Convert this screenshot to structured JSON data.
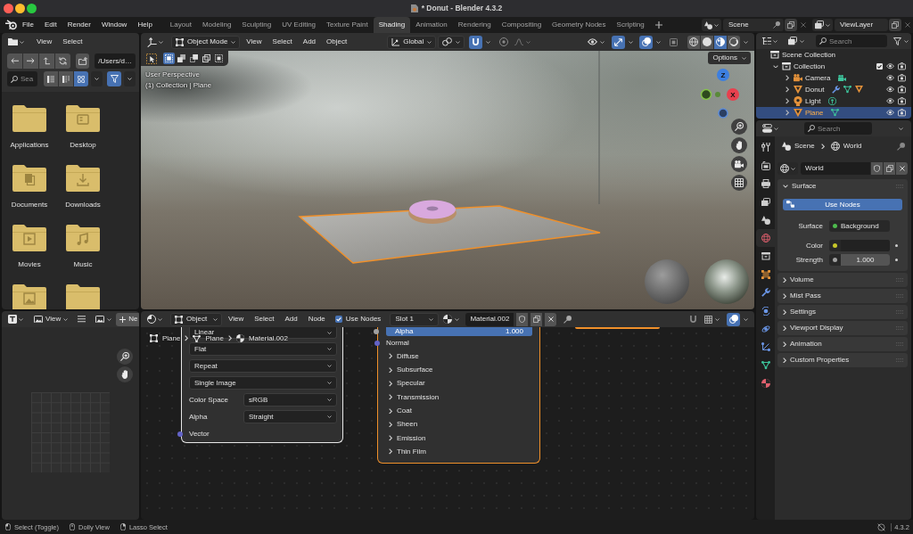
{
  "window": {
    "title": "* Donut - Blender 4.3.2"
  },
  "menu": [
    "File",
    "Edit",
    "Render",
    "Window",
    "Help"
  ],
  "workspaces": [
    {
      "label": "Layout",
      "selected": false
    },
    {
      "label": "Modeling",
      "selected": false
    },
    {
      "label": "Sculpting",
      "selected": false
    },
    {
      "label": "UV Editing",
      "selected": false
    },
    {
      "label": "Texture Paint",
      "selected": false
    },
    {
      "label": "Shading",
      "selected": true
    },
    {
      "label": "Animation",
      "selected": false
    },
    {
      "label": "Rendering",
      "selected": false
    },
    {
      "label": "Compositing",
      "selected": false
    },
    {
      "label": "Geometry Nodes",
      "selected": false
    },
    {
      "label": "Scripting",
      "selected": false
    }
  ],
  "scene": "Scene",
  "view_layer": "ViewLayer",
  "file_browser": {
    "menus": [
      "View",
      "Select"
    ],
    "path": "/Users/d…",
    "search": {
      "placeholder": "Sea"
    },
    "display_modes": [
      {
        "kind": "vertical",
        "selected": false
      },
      {
        "kind": "horizontal",
        "selected": false
      },
      {
        "kind": "thumbnails",
        "selected": true
      }
    ],
    "filter": {
      "on": true
    },
    "folders": [
      {
        "name": "Applications",
        "kind": "plain"
      },
      {
        "name": "Desktop",
        "kind": "desktop"
      },
      {
        "name": "Documents",
        "kind": "documents"
      },
      {
        "name": "Downloads",
        "kind": "downloads"
      },
      {
        "name": "Movies",
        "kind": "movies"
      },
      {
        "name": "Music",
        "kind": "music"
      },
      {
        "kind": "pictures"
      },
      {
        "kind": "plain"
      }
    ]
  },
  "image_editor": {
    "mode": "View",
    "new_label": "Ne"
  },
  "viewport": {
    "mode": "Object Mode",
    "menus": [
      "View",
      "Select",
      "Add",
      "Object"
    ],
    "orientation": "Global",
    "snapping": {
      "on": true
    },
    "proportional_editing": {
      "on": false
    },
    "gizmos": {
      "on": true
    },
    "overlays": {
      "on": true
    },
    "xray": {
      "on": false
    },
    "shading_modes": [
      {
        "kind": "wireframe",
        "selected": false
      },
      {
        "kind": "solid",
        "selected": false
      },
      {
        "kind": "material",
        "selected": true
      },
      {
        "kind": "rendered",
        "selected": false
      }
    ],
    "select_modes": [
      {
        "kind": "set",
        "selected": true
      },
      {
        "kind": "extend",
        "selected": false
      },
      {
        "kind": "subtract",
        "selected": false
      },
      {
        "kind": "difference",
        "selected": false
      },
      {
        "kind": "intersect",
        "selected": false
      }
    ],
    "info": [
      "User Perspective",
      "(1) Collection | Plane"
    ],
    "options": "Options",
    "gizmo_axes": [
      {
        "label": "Z",
        "color": "#3d7fe0"
      },
      {
        "label": "X",
        "color": "#e8404e"
      }
    ]
  },
  "shader_editor": {
    "object_type": "Object",
    "menus": [
      "View",
      "Select",
      "Add",
      "Node"
    ],
    "use_nodes": {
      "label": "Use Nodes",
      "checked": true
    },
    "slot": "Slot 1",
    "material": "Material.002",
    "snapping": {
      "on": false
    },
    "overlays": {
      "on": true
    },
    "breadcrumb": [
      "Plane",
      "Plane",
      "Material.002"
    ],
    "image_node": {
      "active": true,
      "selected": true,
      "rows": [
        {
          "kind": "dropdown",
          "value": "Linear"
        },
        {
          "kind": "dropdown",
          "value": "Flat"
        },
        {
          "kind": "dropdown",
          "value": "Repeat"
        },
        {
          "kind": "dropdown",
          "value": "Single Image"
        },
        {
          "kind": "property",
          "label": "Color Space",
          "value": "sRGB"
        },
        {
          "kind": "property",
          "label": "Alpha",
          "value": "Straight"
        },
        {
          "kind": "input",
          "label": "Vector",
          "color": "#6363c7"
        }
      ]
    },
    "bsdf_node": {
      "active": false,
      "selected": true,
      "alpha": {
        "label": "Alpha",
        "value": "1.000",
        "level": 1,
        "color": "#a1a1a1"
      },
      "inputs": [
        {
          "label": "Normal",
          "color": "#6363c7"
        }
      ],
      "panels": [
        {
          "label": "Diffuse",
          "expanded": false
        },
        {
          "label": "Subsurface",
          "expanded": false
        },
        {
          "label": "Specular",
          "expanded": false
        },
        {
          "label": "Transmission",
          "expanded": false
        },
        {
          "label": "Coat",
          "expanded": false
        },
        {
          "label": "Sheen",
          "expanded": false
        },
        {
          "label": "Emission",
          "expanded": false
        },
        {
          "label": "Thin Film",
          "expanded": false
        }
      ]
    }
  },
  "outliner": {
    "search": {
      "placeholder": "Search"
    },
    "tree": [
      {
        "name": "Scene Collection",
        "kind": "scene",
        "selected": false,
        "children": [
          {
            "name": "Collection",
            "kind": "collection",
            "selected": false,
            "expanded": true,
            "checked": true,
            "visible": true,
            "children": [
              {
                "name": "Camera",
                "kind": "camera",
                "selected": false,
                "expanded": false,
                "visible": true,
                "badges": [
                  {
                    "kind": "camera-data"
                  }
                ]
              },
              {
                "name": "Donut",
                "kind": "mesh",
                "selected": false,
                "expanded": false,
                "visible": true,
                "badges": [
                  {
                    "kind": "modifier"
                  },
                  {
                    "kind": "mesh-data"
                  },
                  {
                    "kind": "mesh-object"
                  }
                ]
              },
              {
                "name": "Light",
                "kind": "light",
                "selected": false,
                "expanded": false,
                "visible": true,
                "badges": [
                  {
                    "kind": "light-data"
                  }
                ]
              },
              {
                "name": "Plane",
                "kind": "mesh",
                "selected": true,
                "expanded": false,
                "visible": true,
                "badges": [
                  {
                    "kind": "mesh-data"
                  }
                ]
              }
            ]
          }
        ]
      }
    ]
  },
  "properties": {
    "search": {
      "placeholder": "Search"
    },
    "tabs": [
      {
        "kind": "tool",
        "selected": false
      },
      {
        "kind": "render",
        "selected": false
      },
      {
        "kind": "output",
        "selected": false
      },
      {
        "kind": "view-layer",
        "selected": false
      },
      {
        "kind": "scene",
        "selected": false
      },
      {
        "kind": "world",
        "selected": true
      },
      {
        "kind": "collection",
        "selected": false
      },
      {
        "kind": "object",
        "selected": false
      },
      {
        "kind": "modifiers",
        "selected": false
      },
      {
        "kind": "particles",
        "selected": false
      },
      {
        "kind": "physics",
        "selected": false
      },
      {
        "kind": "constraints",
        "selected": false
      },
      {
        "kind": "data",
        "selected": false
      },
      {
        "kind": "material",
        "selected": false
      }
    ],
    "breadcrumb": [
      "Scene",
      "World"
    ],
    "world": "World",
    "panels": [
      {
        "title": "Surface",
        "expanded": true,
        "button": "Use Nodes",
        "rows": [
          {
            "kind": "link",
            "label": "Surface",
            "value": "Background",
            "color": "#4dbb4d"
          },
          {
            "kind": "color",
            "label": "Color",
            "color": "#c7c729"
          },
          {
            "kind": "number",
            "label": "Strength",
            "value": "1.000",
            "color": "#a1a1a1"
          }
        ]
      },
      {
        "title": "Volume",
        "expanded": false
      },
      {
        "title": "Mist Pass",
        "expanded": false
      },
      {
        "title": "Settings",
        "expanded": false
      },
      {
        "title": "Viewport Display",
        "expanded": false
      },
      {
        "title": "Animation",
        "expanded": false
      },
      {
        "title": "Custom Properties",
        "expanded": false
      }
    ]
  },
  "status_bar": {
    "hints": [
      {
        "kind": "left",
        "label": "Select (Toggle)"
      },
      {
        "kind": "middle",
        "label": "Dolly View"
      },
      {
        "kind": "right",
        "label": "Lasso Select"
      }
    ],
    "version": "4.3.2"
  }
}
